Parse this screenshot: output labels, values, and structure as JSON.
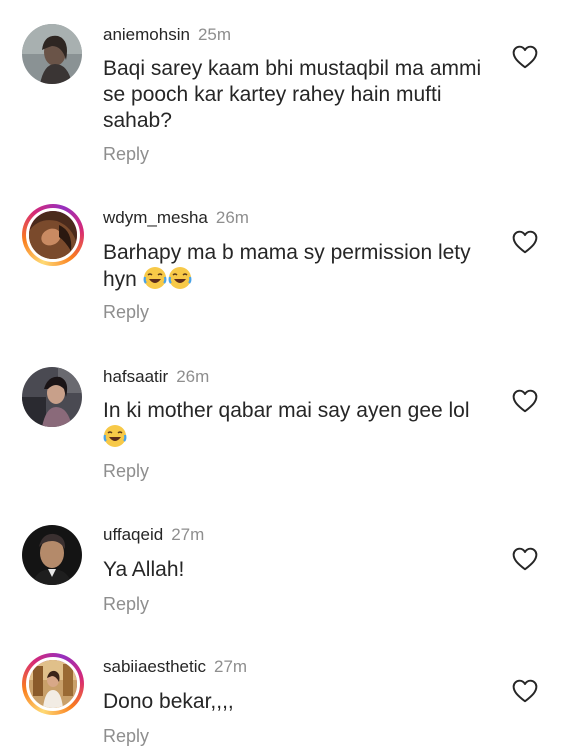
{
  "comments": [
    {
      "username": "aniemohsin",
      "time": "25m",
      "text": "Baqi sarey kaam bhi mustaqbil ma ammi se pooch kar kartey rahey hain mufti sahab?",
      "reply_label": "Reply",
      "story_ring": false
    },
    {
      "username": "wdym_mesha",
      "time": "26m",
      "text": "Barhapy ma b mama sy permission lety hyn",
      "emojis": [
        "laughing-emoji",
        "laughing-emoji"
      ],
      "reply_label": "Reply",
      "story_ring": true
    },
    {
      "username": "hafsaatir",
      "time": "26m",
      "text": "In ki mother qabar mai say ayen gee lol",
      "emojis": [
        "laughing-emoji"
      ],
      "reply_label": "Reply",
      "story_ring": false
    },
    {
      "username": "uffaqeid",
      "time": "27m",
      "text": "Ya Allah!",
      "reply_label": "Reply",
      "story_ring": false
    },
    {
      "username": "sabiiaesthetic",
      "time": "27m",
      "text": "Dono bekar,,,,",
      "reply_label": "Reply",
      "story_ring": true
    }
  ]
}
